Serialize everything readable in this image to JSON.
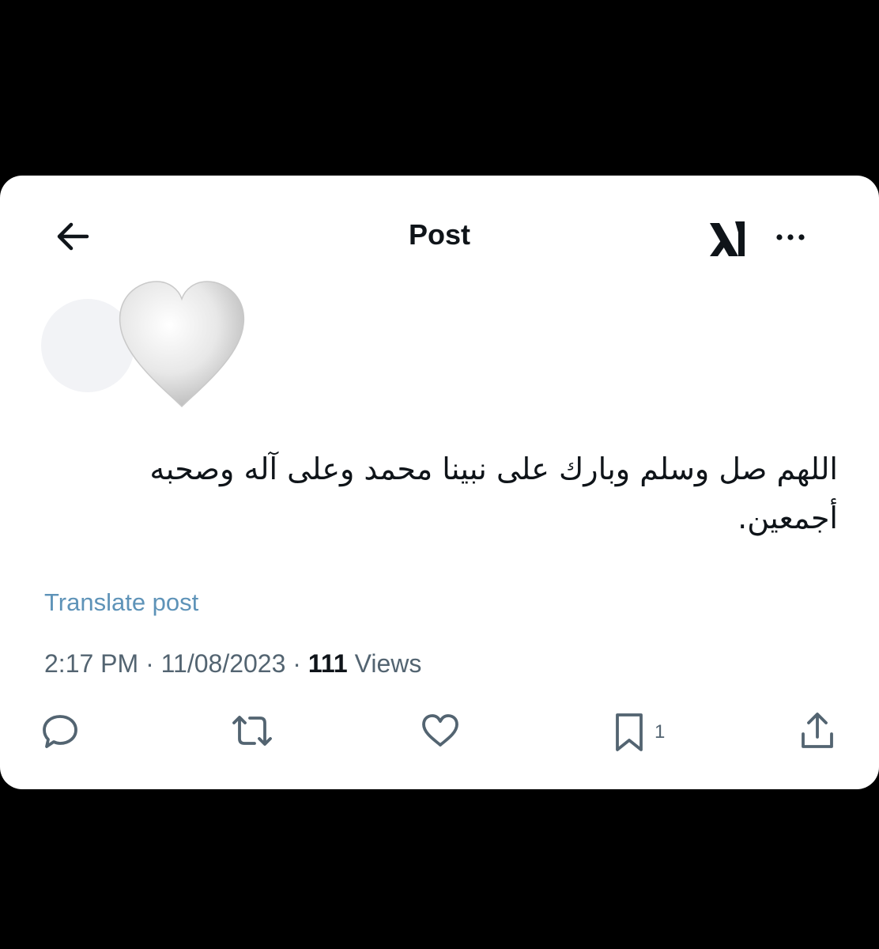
{
  "header": {
    "title": "Post"
  },
  "icons": {
    "back": "arrow-left-icon",
    "logo": "xai-logo",
    "more": "more-horizontal-icon",
    "avatar_emoji": "white-heart-emoji",
    "reply": "comment-icon",
    "repost": "repost-icon",
    "like": "heart-icon",
    "bookmark": "bookmark-icon",
    "share": "share-icon"
  },
  "post": {
    "text": "اللهم صل وسلم وبارك على نبينا محمد وعلى آله وصحبه أجمعين.",
    "translate_label": "Translate post",
    "time": "2:17 PM",
    "date": "11/08/2023",
    "separator": "·",
    "views_count": "111",
    "views_label": "Views"
  },
  "actions": {
    "bookmark_count": "1"
  },
  "colors": {
    "background": "#000000",
    "card": "#ffffff",
    "text": "#0f1419",
    "muted": "#536471",
    "link": "#5e93b8"
  }
}
